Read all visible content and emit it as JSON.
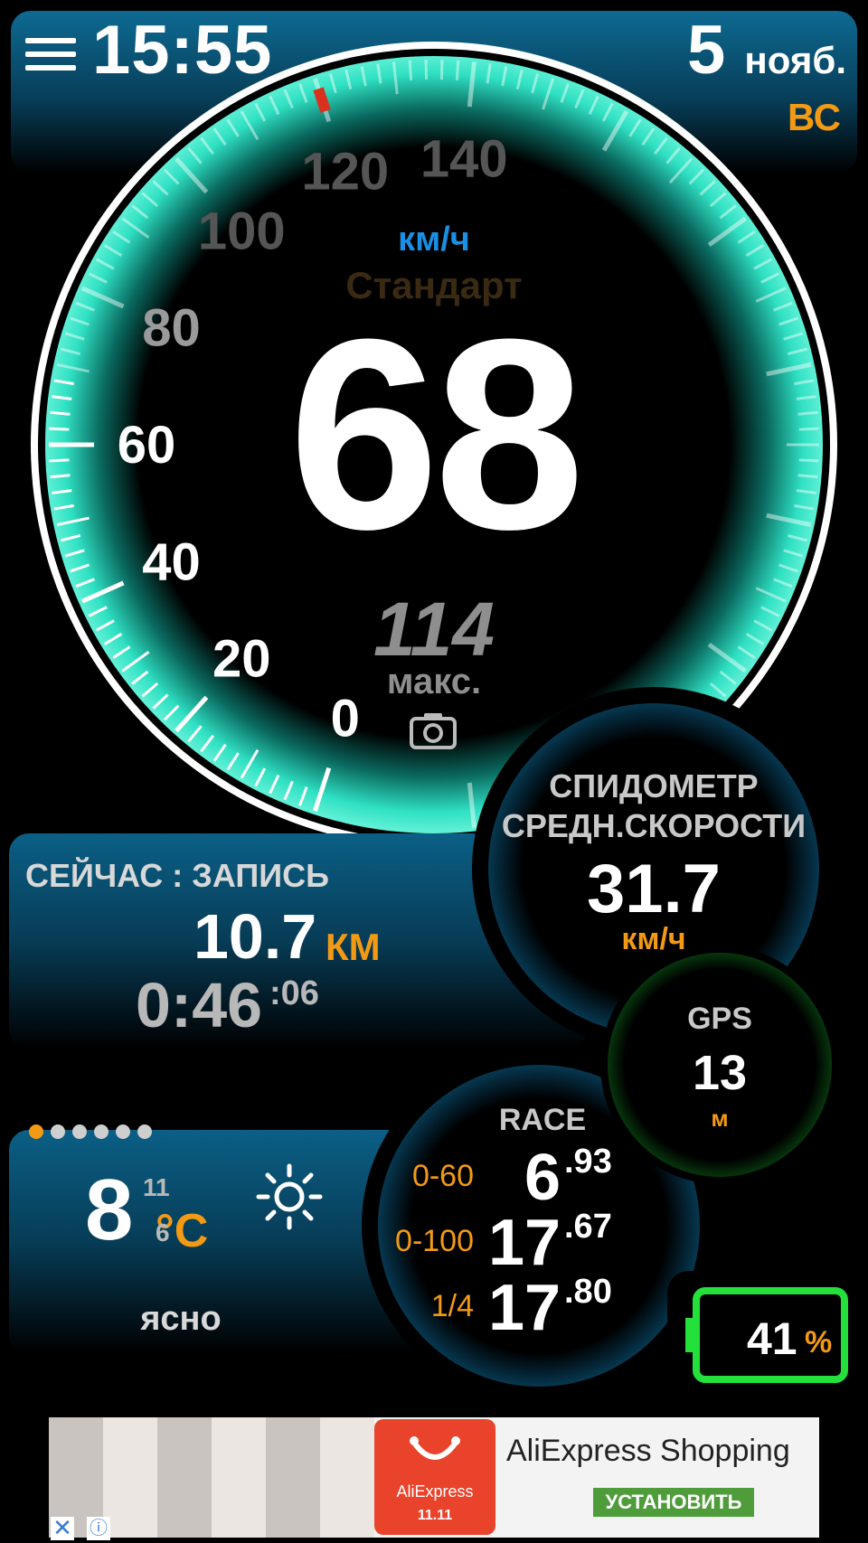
{
  "status": {
    "time": "15:55",
    "day": "5",
    "month": "нояб.",
    "weekday": "ВС"
  },
  "speedometer": {
    "unit": "км/ч",
    "mode": "Стандарт",
    "current_speed": "68",
    "max_speed": "114",
    "max_label": "макс.",
    "dial_max": 140,
    "dial_labels": [
      "0",
      "20",
      "40",
      "60",
      "80",
      "100",
      "120",
      "140"
    ],
    "accent_color": "#2fe0c2"
  },
  "recording": {
    "title": "СЕЙЧАС : ЗАПИСЬ",
    "distance": "10.7",
    "distance_unit": "КМ",
    "elapsed": "0:46",
    "elapsed_seconds": ":06"
  },
  "average": {
    "title_line1": "СПИДОМЕТР",
    "title_line2": "СРЕДН.СКОРОСТИ",
    "value": "31.7",
    "unit": "км/ч"
  },
  "gps": {
    "title": "GPS",
    "accuracy": "13",
    "unit": "м",
    "color": "#23e03a"
  },
  "weather": {
    "temperature": "8",
    "high": "11",
    "low": "6",
    "unit": "°C",
    "condition": "ясно",
    "icon": "sun-icon",
    "pages": 6,
    "active_page": 1
  },
  "race": {
    "title": "RACE",
    "rows": [
      {
        "label": "0-60",
        "value": "6",
        "fraction": ".93"
      },
      {
        "label": "0-100",
        "value": "17",
        "fraction": ".67"
      },
      {
        "label": "1/4",
        "value": "17",
        "fraction": ".80"
      }
    ]
  },
  "battery": {
    "level": "41",
    "unit": "%",
    "fraction": 0.41,
    "color": "#23e03a"
  },
  "ad": {
    "title": "AliExpress Shopping",
    "button": "УСТАНОВИТЬ",
    "logo_text": "AliExpress",
    "logo_sub": "11.11",
    "close": "✕",
    "info": "ⓘ"
  }
}
